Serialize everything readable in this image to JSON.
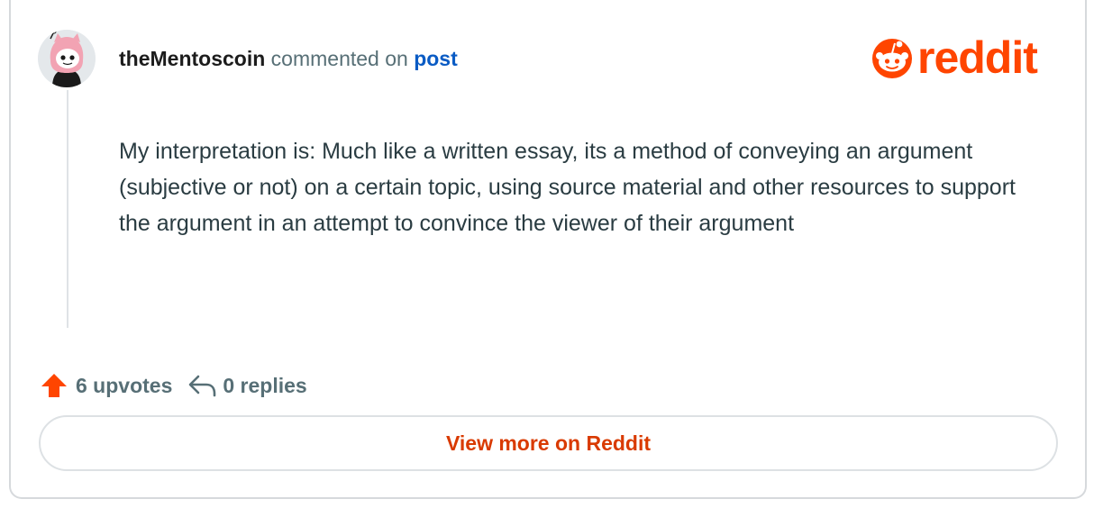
{
  "comment": {
    "username": "theMentoscoin",
    "action_text": "commented on",
    "post_link_label": "post",
    "body": "My interpretation is: Much like a written essay, its a method of conveying an argument (subjective or not) on a certain topic, using source material and other resources to support the argument in an attempt to convince the viewer of their argument"
  },
  "brand": {
    "name": "reddit",
    "color": "#ff4500"
  },
  "stats": {
    "upvotes_label": "6 upvotes",
    "replies_label": "0 replies"
  },
  "footer": {
    "view_more_label": "View more on Reddit"
  },
  "icons": {
    "upvote": "upvote-arrow-icon",
    "reply": "reply-arrow-icon",
    "avatar": "snoo-avatar"
  }
}
